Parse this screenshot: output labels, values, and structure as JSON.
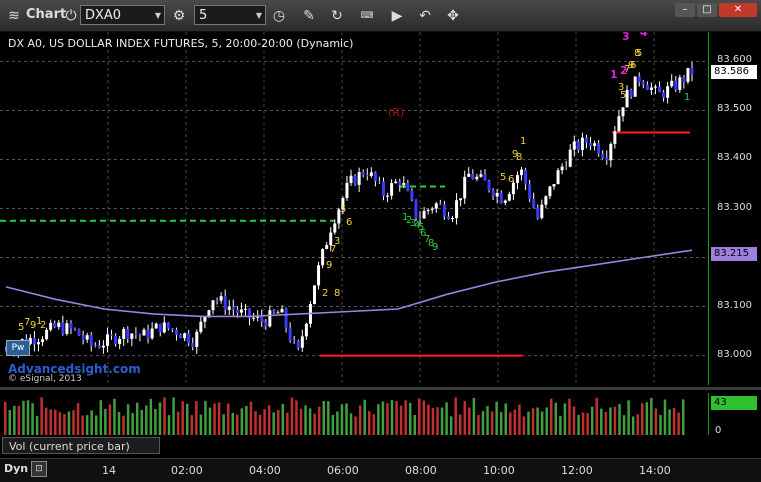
{
  "toolbar": {
    "chart_label": "Chart",
    "symbol": "DXA0",
    "interval": "5",
    "icons": [
      "chart-lines-icon",
      "power-icon",
      "gear-icon",
      "clock-icon",
      "pencil-icon",
      "refresh-icon",
      "keyboard-icon",
      "play-icon",
      "arrow-back-icon",
      "move-icon"
    ]
  },
  "chart": {
    "title": "DX A0, US DOLLAR INDEX FUTURES, 5, 20:00-20:00 (Dynamic)",
    "watermark_1": "Advancedsight.com",
    "watermark_2": "© eSignal, 2013",
    "r_marker": "(R)",
    "price_tag": "83.586",
    "ma_tag": "83.215",
    "vol_tag": "43",
    "vol_zero": "0",
    "volume_label": "Vol (current price bar)",
    "dyn_label": "Dyn"
  },
  "chart_data": {
    "type": "candlestick",
    "title": "DX A0, US DOLLAR INDEX FUTURES, 5, 20:00-20:00 (Dynamic)",
    "y_ticks": [
      "83.600",
      "83.500",
      "83.400",
      "83.300",
      "83.200",
      "83.100",
      "83.000"
    ],
    "ylim": [
      82.94,
      83.66
    ],
    "x_ticks": [
      "14",
      "02:00",
      "04:00",
      "06:00",
      "08:00",
      "10:00",
      "12:00",
      "14:00"
    ],
    "last_price": 83.586,
    "moving_average_last": 83.215,
    "moving_average": [
      83.14,
      83.115,
      83.095,
      83.085,
      83.08,
      83.08,
      83.085,
      83.09,
      83.095,
      83.125,
      83.15,
      83.17,
      83.185,
      83.2,
      83.215
    ],
    "close_path": [
      83.01,
      83.03,
      83.04,
      83.06,
      83.05,
      83.02,
      83.03,
      83.05,
      83.04,
      83.06,
      83.05,
      83.03,
      83.12,
      83.1,
      83.08,
      83.07,
      83.09,
      83.0,
      83.15,
      83.27,
      83.35,
      83.38,
      83.33,
      83.36,
      83.28,
      83.31,
      83.29,
      83.37,
      83.35,
      83.32,
      83.38,
      83.28,
      83.36,
      83.42,
      83.44,
      83.41,
      83.52,
      83.57,
      83.53,
      83.55,
      83.58
    ],
    "levels": [
      {
        "name": "green-dashed",
        "value": 83.275,
        "color": "#2ecc40"
      },
      {
        "name": "green-dashed-short",
        "value": 83.345,
        "color": "#2ecc40"
      },
      {
        "name": "red-support",
        "value": 83.0,
        "color": "#ff2020"
      },
      {
        "name": "red-resistance",
        "value": 83.455,
        "color": "#ff2020"
      }
    ],
    "annotations_yellow": [
      "5",
      "7",
      "9",
      "1",
      "2",
      "3",
      "5",
      "6",
      "7",
      "8",
      "9",
      "2",
      "5",
      "6",
      "8",
      "9",
      "1",
      "3",
      "5",
      "7",
      "9",
      "5",
      "6",
      "8"
    ],
    "annotations_green": [
      "1",
      "2",
      "3",
      "4",
      "5",
      "6",
      "7",
      "8",
      "9",
      "1"
    ],
    "annotations_magenta": [
      "3",
      "4",
      "1",
      "2"
    ]
  },
  "colors": {
    "background": "#000000",
    "up_candle": "#ffffff",
    "down_candle": "#3a3aff",
    "moving_average": "#9f7fe0",
    "volume_up": "#40a040",
    "volume_down": "#c03030",
    "price_tag_bg": "#ffffff",
    "ma_tag_bg": "#9f7fe0",
    "vol_tag_bg": "#30c030"
  }
}
